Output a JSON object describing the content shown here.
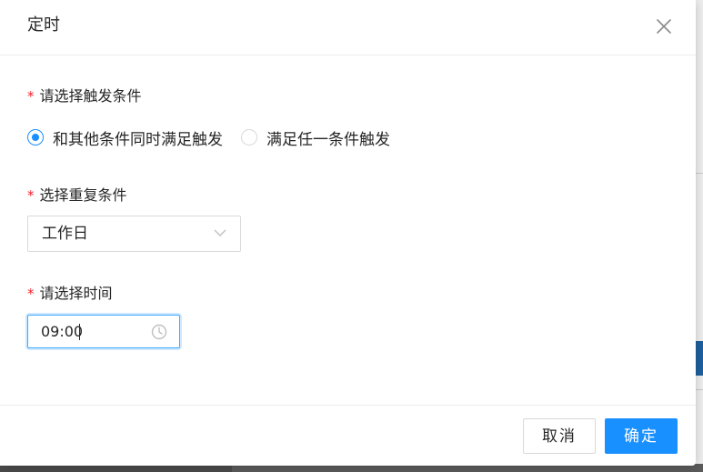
{
  "modal": {
    "title": "定时",
    "close_icon": "close-icon"
  },
  "trigger": {
    "required_mark": "*",
    "label": "请选择触发条件",
    "options": [
      {
        "label": "和其他条件同时满足触发",
        "checked": true
      },
      {
        "label": "满足任一条件触发",
        "checked": false
      }
    ]
  },
  "repeat": {
    "required_mark": "*",
    "label": "选择重复条件",
    "value": "工作日",
    "arrow_icon": "chevron-down-icon"
  },
  "time": {
    "required_mark": "*",
    "label": "请选择时间",
    "value": "09:00",
    "icon": "clock-icon"
  },
  "footer": {
    "cancel_label": "取消",
    "ok_label": "确定"
  },
  "colors": {
    "primary": "#1890ff",
    "required": "#f5222d",
    "border": "#d9d9d9"
  }
}
